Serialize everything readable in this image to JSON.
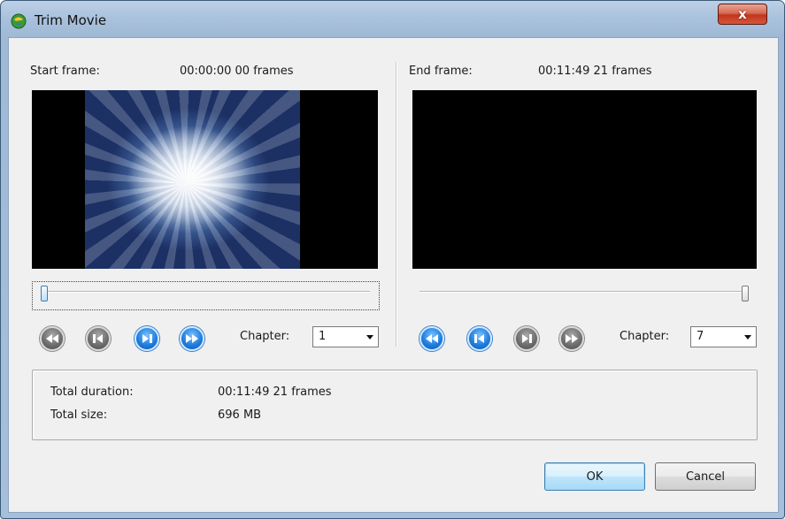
{
  "window": {
    "title": "Trim Movie",
    "close_label": "x"
  },
  "start": {
    "label": "Start frame:",
    "time": "00:00:00 00 frames",
    "chapter_label": "Chapter:",
    "chapter_value": "1",
    "slider_position": 0.0
  },
  "end": {
    "label": "End frame:",
    "time": "00:11:49 21 frames",
    "chapter_label": "Chapter:",
    "chapter_value": "7",
    "slider_position": 1.0
  },
  "nav_buttons": {
    "start": [
      {
        "name": "previous-chapter",
        "icon": "skip-back-icon",
        "style": "gray"
      },
      {
        "name": "previous-frame",
        "icon": "step-back-icon",
        "style": "gray"
      },
      {
        "name": "next-frame",
        "icon": "step-forward-icon",
        "style": "blue"
      },
      {
        "name": "next-chapter",
        "icon": "skip-forward-icon",
        "style": "blue"
      }
    ],
    "end": [
      {
        "name": "previous-chapter",
        "icon": "skip-back-icon",
        "style": "blue"
      },
      {
        "name": "previous-frame",
        "icon": "step-back-icon",
        "style": "blue"
      },
      {
        "name": "next-frame",
        "icon": "step-forward-icon",
        "style": "gray"
      },
      {
        "name": "next-chapter",
        "icon": "skip-forward-icon",
        "style": "gray"
      }
    ]
  },
  "summary": {
    "duration_label": "Total duration:",
    "duration_value": "00:11:49 21 frames",
    "size_label": "Total size:",
    "size_value": "696 MB"
  },
  "buttons": {
    "ok": "OK",
    "cancel": "Cancel"
  },
  "colors": {
    "accent_blue": "#1f7fe0",
    "close_red": "#c2361d"
  }
}
